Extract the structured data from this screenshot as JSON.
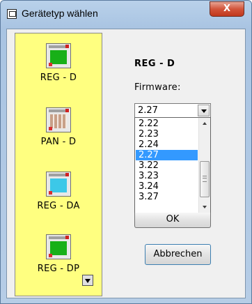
{
  "window": {
    "title": "Gerätetyp wählen",
    "close_label": "X"
  },
  "devices": [
    {
      "label": "REG - D",
      "icon": "reg-d-device-icon",
      "screen_color": "#18b018"
    },
    {
      "label": "PAN - D",
      "icon": "pan-d-device-icon",
      "screen_color": "#c8a088"
    },
    {
      "label": "REG - DA",
      "icon": "reg-da-device-icon",
      "screen_color": "#3cc8e8"
    },
    {
      "label": "REG - DP",
      "icon": "reg-dp-device-icon",
      "screen_color": "#18b018"
    }
  ],
  "selected_device": "REG - D",
  "firmware": {
    "label": "Firmware:",
    "value": "2.27",
    "options": [
      "2.22",
      "2.23",
      "2.24",
      "2.27",
      "3.22",
      "3.23",
      "3.24",
      "3.27"
    ],
    "selected_option": "2.27"
  },
  "buttons": {
    "ok": "OK",
    "cancel": "Abbrechen"
  },
  "colors": {
    "device_panel": "#ffff80",
    "selection": "#3399ff"
  }
}
